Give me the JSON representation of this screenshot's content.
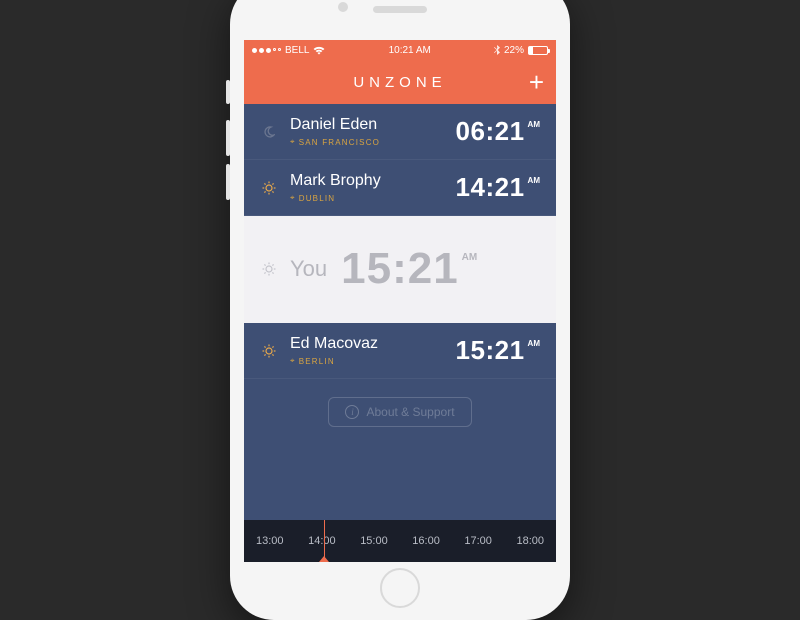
{
  "statusbar": {
    "carrier": "BELL",
    "time": "10:21 AM",
    "battery_pct": "22%"
  },
  "header": {
    "title": "UNZONE",
    "add_label": "+"
  },
  "contacts": [
    {
      "name": "Daniel Eden",
      "location": "SAN FRANCISCO",
      "time": "06:21",
      "ampm": "AM",
      "icon": "moon"
    },
    {
      "name": "Mark Brophy",
      "location": "DUBLIN",
      "time": "14:21",
      "ampm": "AM",
      "icon": "sun"
    }
  ],
  "you": {
    "label": "You",
    "time": "15:21",
    "ampm": "AM",
    "icon": "sun"
  },
  "contacts_after": [
    {
      "name": "Ed Macovaz",
      "location": "BERLIN",
      "time": "15:21",
      "ampm": "AM",
      "icon": "sun"
    }
  ],
  "about_label": "About & Support",
  "timeline": [
    "13:00",
    "14:00",
    "15:00",
    "16:00",
    "17:00",
    "18:00"
  ]
}
